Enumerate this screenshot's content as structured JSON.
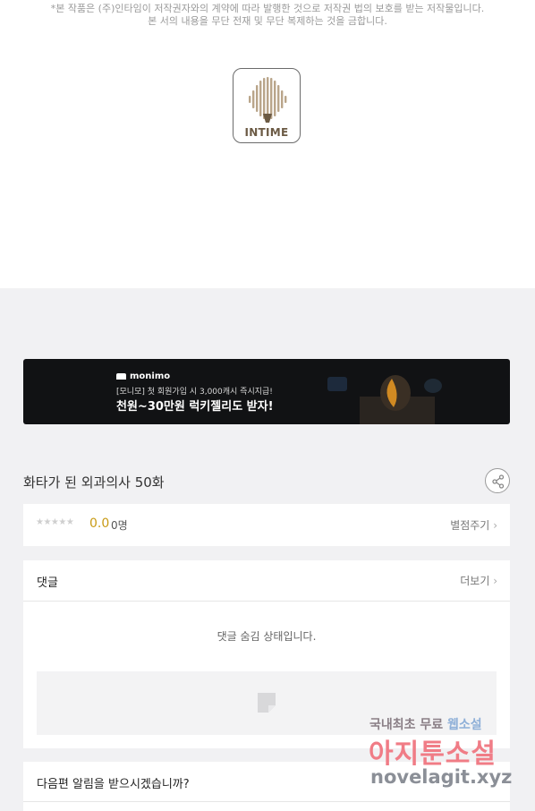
{
  "copyright": {
    "line1": "*본 작품은 (주)인타임이 저작권자와의 계약에 따라 발행한 것으로 저작권 법의 보호를 받는 저작물입니다.",
    "line2": "본 서의 내용을 무단 전재 및 무단 복제하는 것을 금합니다."
  },
  "publisher_logo": {
    "text": "INTIME",
    "color": "#6b5a44"
  },
  "banner": {
    "brand": "monimo",
    "subtitle": "[모니모] 첫 회원가입 시 3,000캐시 즉시지급!",
    "headline": "천원~30만원 럭키젤리도 받자!",
    "background": "#111214"
  },
  "episode": {
    "title": "화타가 된 외과의사 50화",
    "share_icon": "share-icon"
  },
  "rating": {
    "stars": "★★★★★",
    "score": "0.0",
    "count": "0명",
    "rate_button": "별점주기",
    "score_color": "#c89a14"
  },
  "comments": {
    "title": "댓글",
    "more": "더보기",
    "hidden_message": "댓글 숨김 상태입니다.",
    "input_icon": "comment-icon"
  },
  "notify": {
    "question": "다음편 알림을 받으시겠습니까?"
  },
  "watermark": {
    "line1_a": "국내최초 무료",
    "line1_b": "웹소설",
    "line2": "아지툰소설",
    "line3": "novelagit.xyz"
  }
}
